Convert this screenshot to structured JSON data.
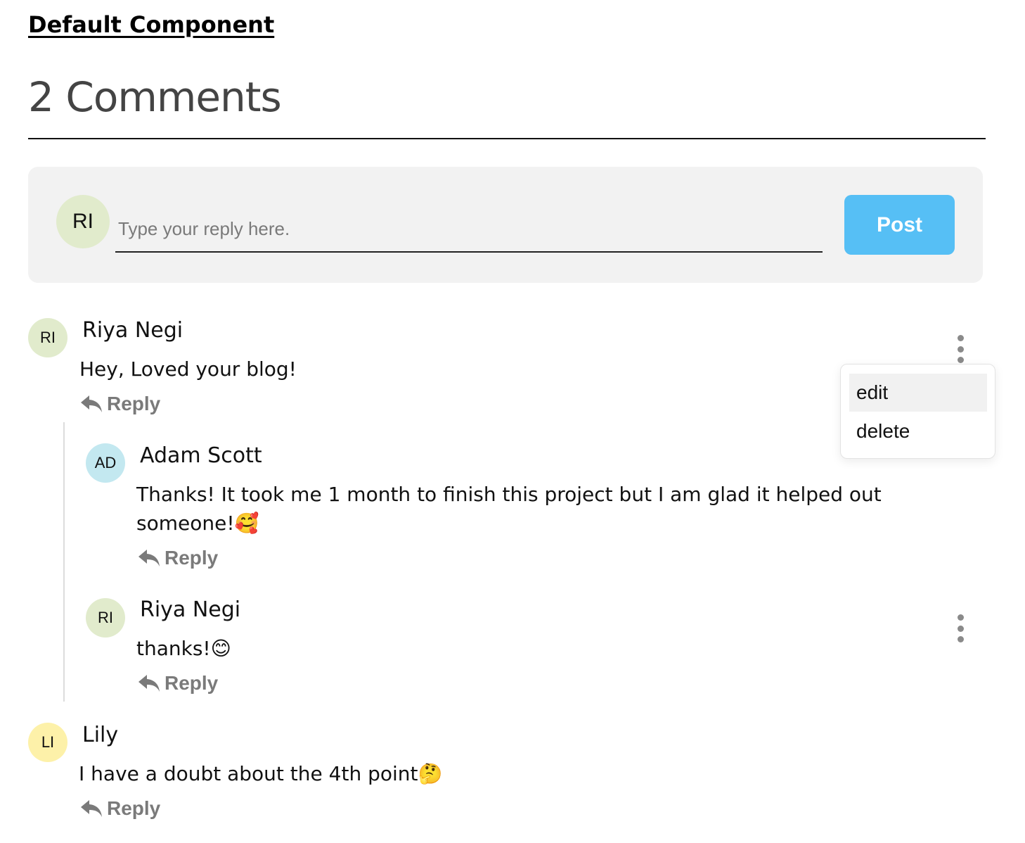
{
  "page": {
    "heading": "Default Component",
    "comments_title": "2 Comments"
  },
  "composer": {
    "avatar_initials": "RI",
    "placeholder": "Type your reply here.",
    "value": "",
    "post_label": "Post",
    "post_color": "#56bff5"
  },
  "comments": [
    {
      "initials": "RI",
      "author": "Riya Negi",
      "text": "Hey, Loved your blog!",
      "reply_label": "Reply",
      "avatar_color": "#e1ebcc",
      "menu_icon": "more-vertical-icon",
      "replies": [
        {
          "initials": "AD",
          "author": "Adam Scott",
          "text": "Thanks! It took me 1 month to finish this project but I am glad it helped out someone!🥰",
          "reply_label": "Reply",
          "avatar_color": "#c3e8f0"
        },
        {
          "initials": "RI",
          "author": "Riya Negi",
          "text": "thanks!😊",
          "reply_label": "Reply",
          "avatar_color": "#e1ebcc",
          "menu_icon": "more-vertical-icon"
        }
      ]
    },
    {
      "initials": "LI",
      "author": "Lily",
      "text": "I have a doubt about the 4th point🤔",
      "reply_label": "Reply",
      "avatar_color": "#fdf1a9"
    }
  ],
  "menu": {
    "items": [
      "edit",
      "delete"
    ],
    "highlighted": "edit"
  },
  "icons": {
    "reply": "reply-arrow-icon",
    "more": "more-vertical-icon"
  }
}
